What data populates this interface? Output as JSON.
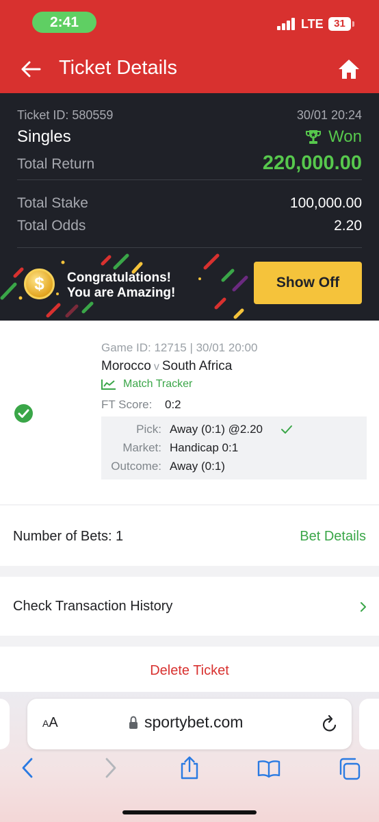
{
  "status_bar": {
    "time": "2:41",
    "network": "LTE",
    "battery": "31"
  },
  "header": {
    "title": "Ticket Details"
  },
  "summary": {
    "ticket_id": "Ticket ID: 580559",
    "date": "30/01 20:24",
    "bet_type": "Singles",
    "status": "Won",
    "total_return_label": "Total Return",
    "total_return": "220,000.00",
    "total_stake_label": "Total Stake",
    "total_stake": "100,000.00",
    "total_odds_label": "Total Odds",
    "total_odds": "2.20"
  },
  "banner": {
    "coin_symbol": "$",
    "line1": "Congratulations!",
    "line2": "You are Amazing!",
    "button": "Show Off"
  },
  "match": {
    "game_id": "Game ID: 12715 | 30/01 20:00",
    "home": "Morocco",
    "vs": "v",
    "away": "South Africa",
    "tracker": "Match Tracker",
    "ft_label": "FT Score:",
    "ft_value": "0:2",
    "pick_label": "Pick:",
    "pick_value": "Away (0:1) @2.20",
    "market_label": "Market:",
    "market_value": "Handicap 0:1",
    "outcome_label": "Outcome:",
    "outcome_value": "Away (0:1)"
  },
  "bets": {
    "label": "Number of Bets: 1",
    "details": "Bet Details"
  },
  "history": {
    "label": "Check Transaction History"
  },
  "delete": {
    "label": "Delete Ticket"
  },
  "browser": {
    "aa_big": "A",
    "aa_small": "A",
    "url": "sportybet.com"
  },
  "colors": {
    "brand_red": "#d8312f",
    "win_green": "#57c84d",
    "link_green": "#3aa648",
    "banner_yellow": "#f5c33b",
    "dark_bg": "#1f2128"
  },
  "icons": [
    "back-arrow-icon",
    "home-icon",
    "trophy-icon",
    "coin-icon",
    "check-circle-icon",
    "chart-line-icon",
    "check-icon",
    "chevron-right-icon",
    "lock-icon",
    "reload-icon",
    "chevron-left-icon",
    "share-icon",
    "book-icon",
    "tabs-icon"
  ]
}
